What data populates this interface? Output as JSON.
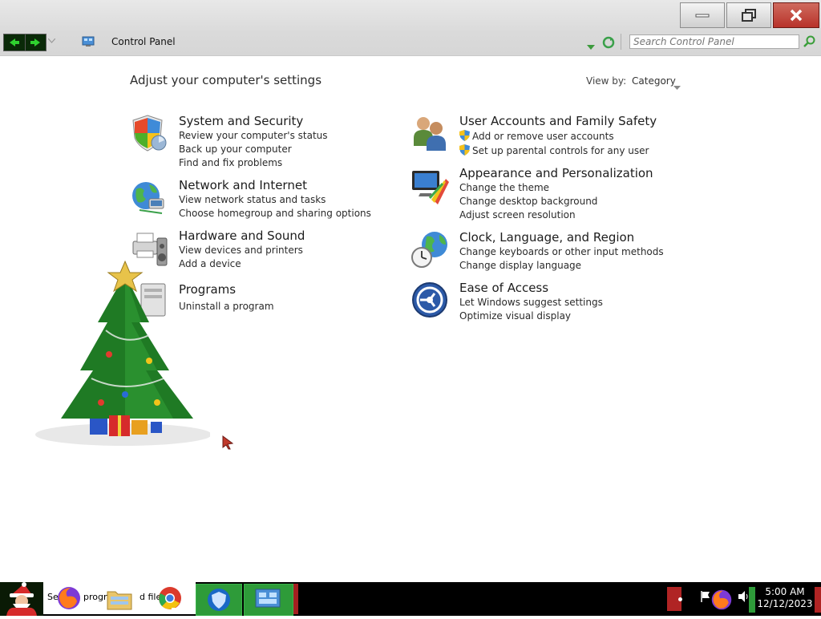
{
  "window": {
    "minimize_icon": "minimize-icon",
    "restore_icon": "restore-icon",
    "close_icon": "close-icon"
  },
  "address_bar": {
    "breadcrumb": "Control Panel",
    "search_placeholder": "Search Control Panel"
  },
  "content": {
    "heading": "Adjust your computer's settings",
    "view_by_label": "View by:",
    "view_by_value": "Category"
  },
  "categories": {
    "system": {
      "title": "System and Security",
      "links": [
        "Review your computer's status",
        "Back up your computer",
        "Find and fix problems"
      ]
    },
    "network": {
      "title": "Network and Internet",
      "links": [
        "View network status and tasks",
        "Choose homegroup and sharing options"
      ]
    },
    "hardware": {
      "title": "Hardware and Sound",
      "links": [
        "View devices and printers",
        "Add a device"
      ]
    },
    "programs": {
      "title": "Programs",
      "links": [
        "Uninstall a program"
      ]
    },
    "user_accounts": {
      "title": "User Accounts and Family Safety",
      "links": [
        "Add or remove user accounts",
        "Set up parental controls for any user"
      ]
    },
    "appearance": {
      "title": "Appearance and Personalization",
      "links": [
        "Change the theme",
        "Change desktop background",
        "Adjust screen resolution"
      ]
    },
    "clock": {
      "title": "Clock, Language, and Region",
      "links": [
        "Change keyboards or other input methods",
        "Change display language"
      ]
    },
    "ease": {
      "title": "Ease of Access",
      "links": [
        "Let Windows suggest settings",
        "Optimize visual display"
      ]
    }
  },
  "taskbar": {
    "item1_label": "Se",
    "item2_label": "progra",
    "item3_label": "d files",
    "time": "5:00 AM",
    "date": "12/12/2023"
  },
  "colors": {
    "close_button": "#c0392b",
    "taskbar": "#000000",
    "taskbar_active": "#2e9b39"
  }
}
